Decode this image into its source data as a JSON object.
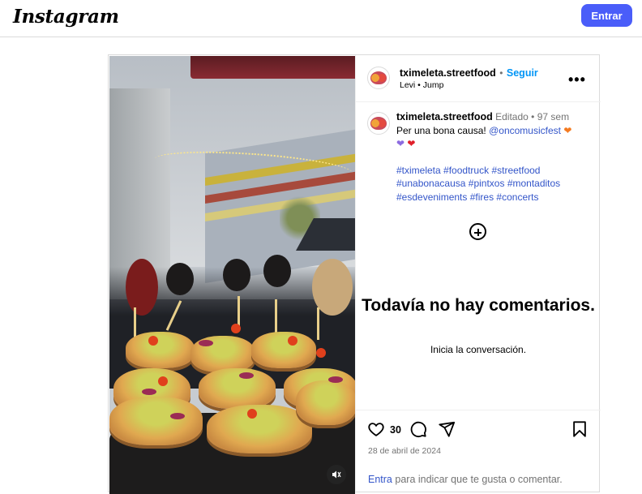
{
  "topbar": {
    "logo": "Instagram",
    "login_button": "Entrar"
  },
  "post": {
    "author": "tximeleta.streetfood",
    "follow_label": "Seguir",
    "separator": "•",
    "audio": "Levi • Jump",
    "caption": {
      "author": "tximeleta.streetfood",
      "edited_label": "Editado",
      "time_ago": "97 sem",
      "text": "Per una bona causa!",
      "mention": "@oncomusicfest",
      "hashtags": [
        "#tximeleta",
        "#foodtruck",
        "#streetfood",
        "#unabonacausa",
        "#pintxos",
        "#montaditos",
        "#esdeveniments",
        "#fires",
        "#concerts"
      ]
    },
    "empty_comments": {
      "title": "Todavía no hay comentarios.",
      "subtitle": "Inicia la conversación."
    },
    "likes": "30",
    "date": "28 de abril de 2024",
    "login_prompt": {
      "link": "Entra",
      "rest": "para indicar que te gusta o comentar."
    }
  },
  "icons": [
    "heart-icon",
    "comment-icon",
    "share-icon",
    "bookmark-icon",
    "more-icon",
    "add-icon",
    "mute-icon"
  ],
  "colors": {
    "accent_button": "#4a5df9",
    "link_blue": "#0095f6",
    "tag_blue": "#3355c9",
    "muted_text": "#737373",
    "border": "#dbdbdb"
  }
}
